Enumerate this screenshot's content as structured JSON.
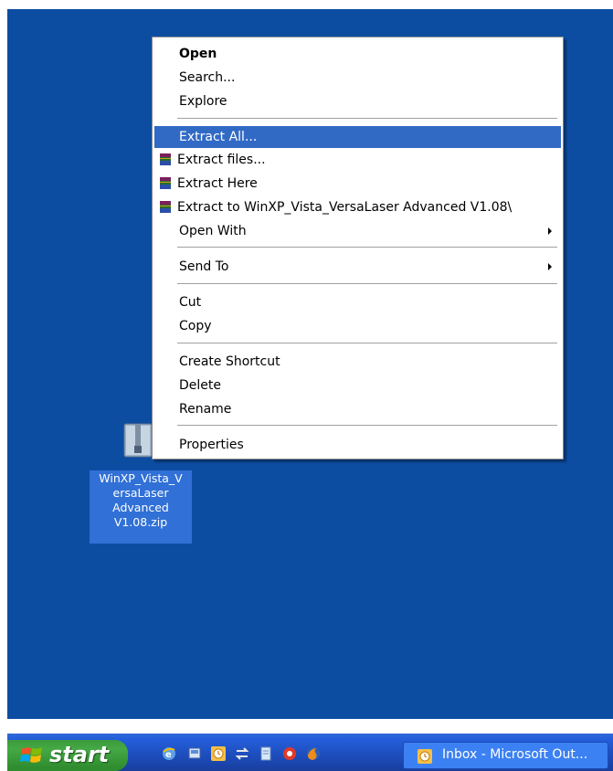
{
  "desktop": {
    "icon_name": "zip-archive-icon",
    "label": "WinXP_Vista_V\nersaLaser\nAdvanced\nV1.08.zip"
  },
  "menu": {
    "items": [
      {
        "label": "Open",
        "bold": true
      },
      {
        "label": "Search..."
      },
      {
        "label": "Explore"
      },
      {
        "label": "Extract All...",
        "highlighted": true
      },
      {
        "label": "Extract files...",
        "icon": "winrar-icon"
      },
      {
        "label": "Extract Here",
        "icon": "winrar-icon"
      },
      {
        "label": "Extract to WinXP_Vista_VersaLaser Advanced V1.08\\",
        "icon": "winrar-icon"
      },
      {
        "label": "Open With",
        "submenu": true
      },
      {
        "label": "Send To",
        "submenu": true
      },
      {
        "label": "Cut"
      },
      {
        "label": "Copy"
      },
      {
        "label": "Create Shortcut"
      },
      {
        "label": "Delete"
      },
      {
        "label": "Rename"
      },
      {
        "label": "Properties"
      }
    ]
  },
  "taskbar": {
    "start_label": "start",
    "quick_launch": [
      "ie-icon",
      "show-desktop-icon",
      "outlook-icon",
      "sync-icon",
      "notepad-icon",
      "media-icon",
      "firefox-icon"
    ],
    "task_button_label": "Inbox - Microsoft Out..."
  },
  "colors": {
    "desktop_bg": "#0c4da2",
    "menu_highlight": "#316ac5",
    "taskbar": "#245edb",
    "start_green": "#3c9a3c"
  }
}
